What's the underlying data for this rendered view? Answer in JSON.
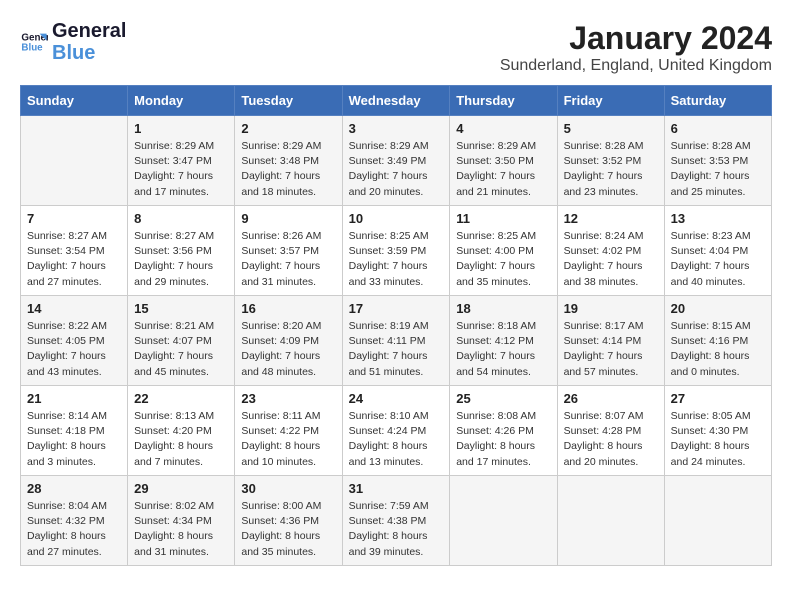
{
  "header": {
    "logo_line1": "General",
    "logo_line2": "Blue",
    "month_year": "January 2024",
    "location": "Sunderland, England, United Kingdom"
  },
  "weekdays": [
    "Sunday",
    "Monday",
    "Tuesday",
    "Wednesday",
    "Thursday",
    "Friday",
    "Saturday"
  ],
  "weeks": [
    [
      {
        "day": "",
        "info": ""
      },
      {
        "day": "1",
        "info": "Sunrise: 8:29 AM\nSunset: 3:47 PM\nDaylight: 7 hours\nand 17 minutes."
      },
      {
        "day": "2",
        "info": "Sunrise: 8:29 AM\nSunset: 3:48 PM\nDaylight: 7 hours\nand 18 minutes."
      },
      {
        "day": "3",
        "info": "Sunrise: 8:29 AM\nSunset: 3:49 PM\nDaylight: 7 hours\nand 20 minutes."
      },
      {
        "day": "4",
        "info": "Sunrise: 8:29 AM\nSunset: 3:50 PM\nDaylight: 7 hours\nand 21 minutes."
      },
      {
        "day": "5",
        "info": "Sunrise: 8:28 AM\nSunset: 3:52 PM\nDaylight: 7 hours\nand 23 minutes."
      },
      {
        "day": "6",
        "info": "Sunrise: 8:28 AM\nSunset: 3:53 PM\nDaylight: 7 hours\nand 25 minutes."
      }
    ],
    [
      {
        "day": "7",
        "info": "Sunrise: 8:27 AM\nSunset: 3:54 PM\nDaylight: 7 hours\nand 27 minutes."
      },
      {
        "day": "8",
        "info": "Sunrise: 8:27 AM\nSunset: 3:56 PM\nDaylight: 7 hours\nand 29 minutes."
      },
      {
        "day": "9",
        "info": "Sunrise: 8:26 AM\nSunset: 3:57 PM\nDaylight: 7 hours\nand 31 minutes."
      },
      {
        "day": "10",
        "info": "Sunrise: 8:25 AM\nSunset: 3:59 PM\nDaylight: 7 hours\nand 33 minutes."
      },
      {
        "day": "11",
        "info": "Sunrise: 8:25 AM\nSunset: 4:00 PM\nDaylight: 7 hours\nand 35 minutes."
      },
      {
        "day": "12",
        "info": "Sunrise: 8:24 AM\nSunset: 4:02 PM\nDaylight: 7 hours\nand 38 minutes."
      },
      {
        "day": "13",
        "info": "Sunrise: 8:23 AM\nSunset: 4:04 PM\nDaylight: 7 hours\nand 40 minutes."
      }
    ],
    [
      {
        "day": "14",
        "info": "Sunrise: 8:22 AM\nSunset: 4:05 PM\nDaylight: 7 hours\nand 43 minutes."
      },
      {
        "day": "15",
        "info": "Sunrise: 8:21 AM\nSunset: 4:07 PM\nDaylight: 7 hours\nand 45 minutes."
      },
      {
        "day": "16",
        "info": "Sunrise: 8:20 AM\nSunset: 4:09 PM\nDaylight: 7 hours\nand 48 minutes."
      },
      {
        "day": "17",
        "info": "Sunrise: 8:19 AM\nSunset: 4:11 PM\nDaylight: 7 hours\nand 51 minutes."
      },
      {
        "day": "18",
        "info": "Sunrise: 8:18 AM\nSunset: 4:12 PM\nDaylight: 7 hours\nand 54 minutes."
      },
      {
        "day": "19",
        "info": "Sunrise: 8:17 AM\nSunset: 4:14 PM\nDaylight: 7 hours\nand 57 minutes."
      },
      {
        "day": "20",
        "info": "Sunrise: 8:15 AM\nSunset: 4:16 PM\nDaylight: 8 hours\nand 0 minutes."
      }
    ],
    [
      {
        "day": "21",
        "info": "Sunrise: 8:14 AM\nSunset: 4:18 PM\nDaylight: 8 hours\nand 3 minutes."
      },
      {
        "day": "22",
        "info": "Sunrise: 8:13 AM\nSunset: 4:20 PM\nDaylight: 8 hours\nand 7 minutes."
      },
      {
        "day": "23",
        "info": "Sunrise: 8:11 AM\nSunset: 4:22 PM\nDaylight: 8 hours\nand 10 minutes."
      },
      {
        "day": "24",
        "info": "Sunrise: 8:10 AM\nSunset: 4:24 PM\nDaylight: 8 hours\nand 13 minutes."
      },
      {
        "day": "25",
        "info": "Sunrise: 8:08 AM\nSunset: 4:26 PM\nDaylight: 8 hours\nand 17 minutes."
      },
      {
        "day": "26",
        "info": "Sunrise: 8:07 AM\nSunset: 4:28 PM\nDaylight: 8 hours\nand 20 minutes."
      },
      {
        "day": "27",
        "info": "Sunrise: 8:05 AM\nSunset: 4:30 PM\nDaylight: 8 hours\nand 24 minutes."
      }
    ],
    [
      {
        "day": "28",
        "info": "Sunrise: 8:04 AM\nSunset: 4:32 PM\nDaylight: 8 hours\nand 27 minutes."
      },
      {
        "day": "29",
        "info": "Sunrise: 8:02 AM\nSunset: 4:34 PM\nDaylight: 8 hours\nand 31 minutes."
      },
      {
        "day": "30",
        "info": "Sunrise: 8:00 AM\nSunset: 4:36 PM\nDaylight: 8 hours\nand 35 minutes."
      },
      {
        "day": "31",
        "info": "Sunrise: 7:59 AM\nSunset: 4:38 PM\nDaylight: 8 hours\nand 39 minutes."
      },
      {
        "day": "",
        "info": ""
      },
      {
        "day": "",
        "info": ""
      },
      {
        "day": "",
        "info": ""
      }
    ]
  ]
}
